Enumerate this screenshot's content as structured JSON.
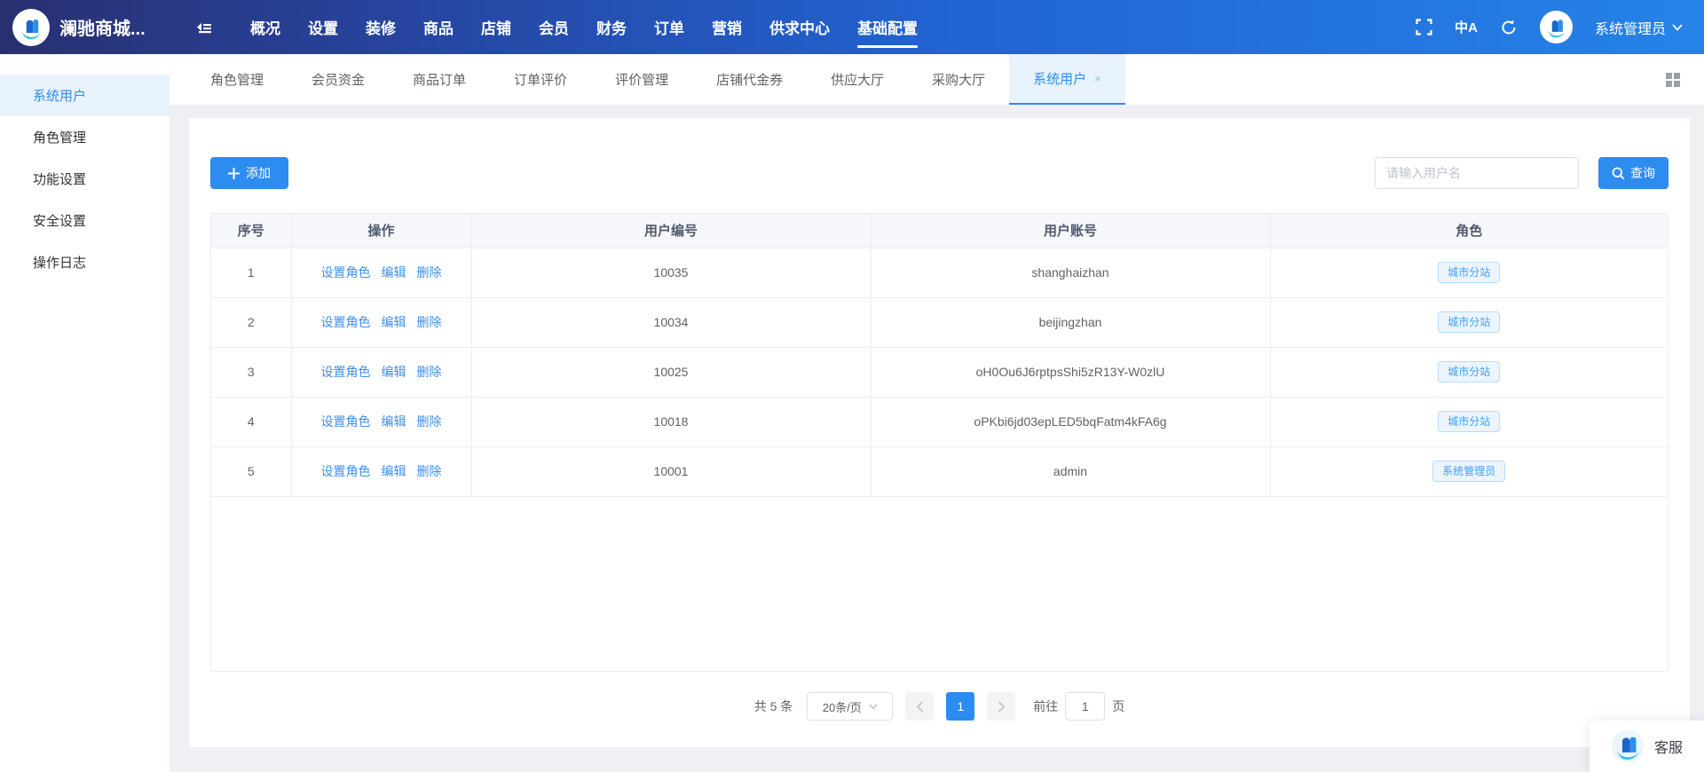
{
  "header": {
    "title": "澜驰商城...",
    "nav": [
      "概况",
      "设置",
      "装修",
      "商品",
      "店铺",
      "会员",
      "财务",
      "订单",
      "营销",
      "供求中心",
      "基础配置"
    ],
    "active_nav": "基础配置",
    "user": "系统管理员"
  },
  "icons": {
    "translate": "中A",
    "tab_close": "×",
    "plus": "+"
  },
  "sidebar": {
    "active": "系统用户",
    "items": [
      "系统用户",
      "角色管理",
      "功能设置",
      "安全设置",
      "操作日志"
    ]
  },
  "tabs": {
    "active": "系统用户",
    "items": [
      "角色管理",
      "会员资金",
      "商品订单",
      "订单评价",
      "评价管理",
      "店铺代金券",
      "供应大厅",
      "采购大厅",
      "系统用户"
    ]
  },
  "toolbar": {
    "add_label": "添加",
    "search_placeholder": "请输入用户名",
    "search_label": "查询"
  },
  "table": {
    "columns": [
      "序号",
      "操作",
      "用户编号",
      "用户账号",
      "角色"
    ],
    "action_labels": [
      "设置角色",
      "编辑",
      "删除"
    ],
    "rows": [
      {
        "seq": "1",
        "user_id": "10035",
        "account": "shanghaizhan",
        "role": "城市分站"
      },
      {
        "seq": "2",
        "user_id": "10034",
        "account": "beijingzhan",
        "role": "城市分站"
      },
      {
        "seq": "3",
        "user_id": "10025",
        "account": "oH0Ou6J6rptpsShi5zR13Y-W0zlU",
        "role": "城市分站"
      },
      {
        "seq": "4",
        "user_id": "10018",
        "account": "oPKbi6jd03epLED5bqFatm4kFA6g",
        "role": "城市分站"
      },
      {
        "seq": "5",
        "user_id": "10001",
        "account": "admin",
        "role": "系统管理员"
      }
    ]
  },
  "pagination": {
    "total": "共 5 条",
    "page_size": "20条/页",
    "page": "1",
    "jump_prefix": "前往",
    "jump_value": "1",
    "jump_suffix": "页"
  },
  "floating": {
    "service_label": "客服"
  },
  "colors": {
    "primary": "#2d8cf0",
    "header_gradient_start": "#293071",
    "header_gradient_end": "#2583e8",
    "active_item_bg": "#e8f3fe",
    "tag_text": "#409eff",
    "tag_bg": "#ecf5ff",
    "tag_border": "#b9dcfb",
    "table_header_bg": "#f5f7fa",
    "table_border": "#ebeef5"
  }
}
